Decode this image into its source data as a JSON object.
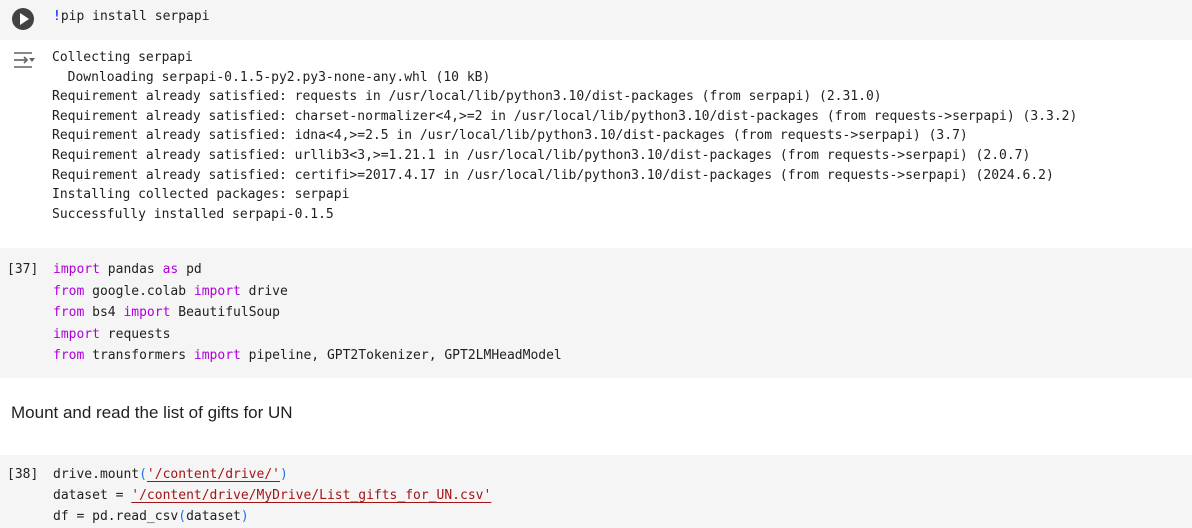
{
  "cell1": {
    "code_bang": "!",
    "code_rest": "pip install serpapi",
    "run_icon": "play-icon",
    "output_icon": "output-collapse-icon",
    "output_lines": [
      "Collecting serpapi",
      "  Downloading serpapi-0.1.5-py2.py3-none-any.whl (10 kB)",
      "Requirement already satisfied: requests in /usr/local/lib/python3.10/dist-packages (from serpapi) (2.31.0)",
      "Requirement already satisfied: charset-normalizer<4,>=2 in /usr/local/lib/python3.10/dist-packages (from requests->serpapi) (3.3.2)",
      "Requirement already satisfied: idna<4,>=2.5 in /usr/local/lib/python3.10/dist-packages (from requests->serpapi) (3.7)",
      "Requirement already satisfied: urllib3<3,>=1.21.1 in /usr/local/lib/python3.10/dist-packages (from requests->serpapi) (2.0.7)",
      "Requirement already satisfied: certifi>=2017.4.17 in /usr/local/lib/python3.10/dist-packages (from requests->serpapi) (2024.6.2)",
      "Installing collected packages: serpapi",
      "Successfully installed serpapi-0.1.5"
    ]
  },
  "cell2": {
    "exec_count": "[37]",
    "l1": {
      "k1": "import",
      "t1": " pandas ",
      "k2": "as",
      "t2": " pd"
    },
    "l2": {
      "k1": "from",
      "t1": " google.colab ",
      "k2": "import",
      "t2": " drive"
    },
    "l3": {
      "k1": "from",
      "t1": " bs4 ",
      "k2": "import",
      "t2": " BeautifulSoup"
    },
    "l4": {
      "k1": "import",
      "t1": " requests"
    },
    "l5": {
      "k1": "from",
      "t1": " transformers ",
      "k2": "import",
      "t2": " pipeline, GPT2Tokenizer, GPT2LMHeadModel"
    }
  },
  "markdown": {
    "text": "Mount and read the list of gifts for UN"
  },
  "cell3": {
    "exec_count": "[38]",
    "l1": {
      "t1": "drive.mount",
      "p1": "(",
      "s1": "'/content/drive/'",
      "p2": ")"
    },
    "l2": {
      "t1": "dataset = ",
      "s1": "'/content/drive/MyDrive/List_gifts_for_UN.csv'"
    },
    "l3": {
      "t1": "df = pd.read_csv",
      "p1": "(",
      "t2": "dataset",
      "p2": ")"
    }
  },
  "colors": {
    "keyword": "#af00db",
    "string": "#a31515",
    "paren": "#1a73e8",
    "cell_bg": "#f5f5f5"
  }
}
